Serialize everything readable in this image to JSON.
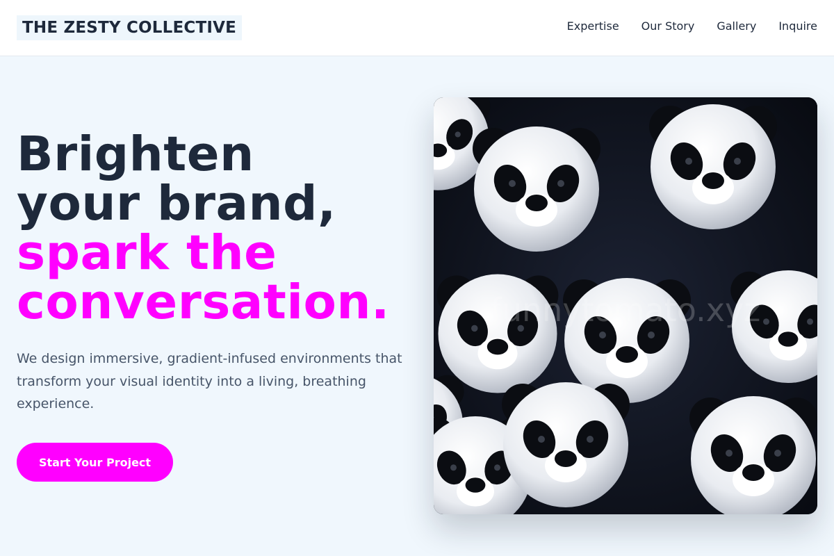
{
  "header": {
    "brand": "THE ZESTY COLLECTIVE",
    "nav": [
      {
        "label": "Expertise"
      },
      {
        "label": "Our Story"
      },
      {
        "label": "Gallery"
      },
      {
        "label": "Inquire"
      }
    ]
  },
  "hero": {
    "title_lines": [
      "Brighten",
      "your brand,"
    ],
    "accent_lines": [
      "spark the",
      "conversation."
    ],
    "subtitle": "We design immersive, gradient-infused environments that transform your visual identity into a living, breathing experience.",
    "cta_label": "Start Your Project"
  },
  "image": {
    "alt": "Pile of plush panda toys",
    "watermark": "funnytomato.xyz"
  },
  "colors": {
    "accent": "#ff00ff",
    "text_dark": "#1e293b",
    "text_muted": "#475569",
    "page_bg": "#f0f7fd"
  }
}
